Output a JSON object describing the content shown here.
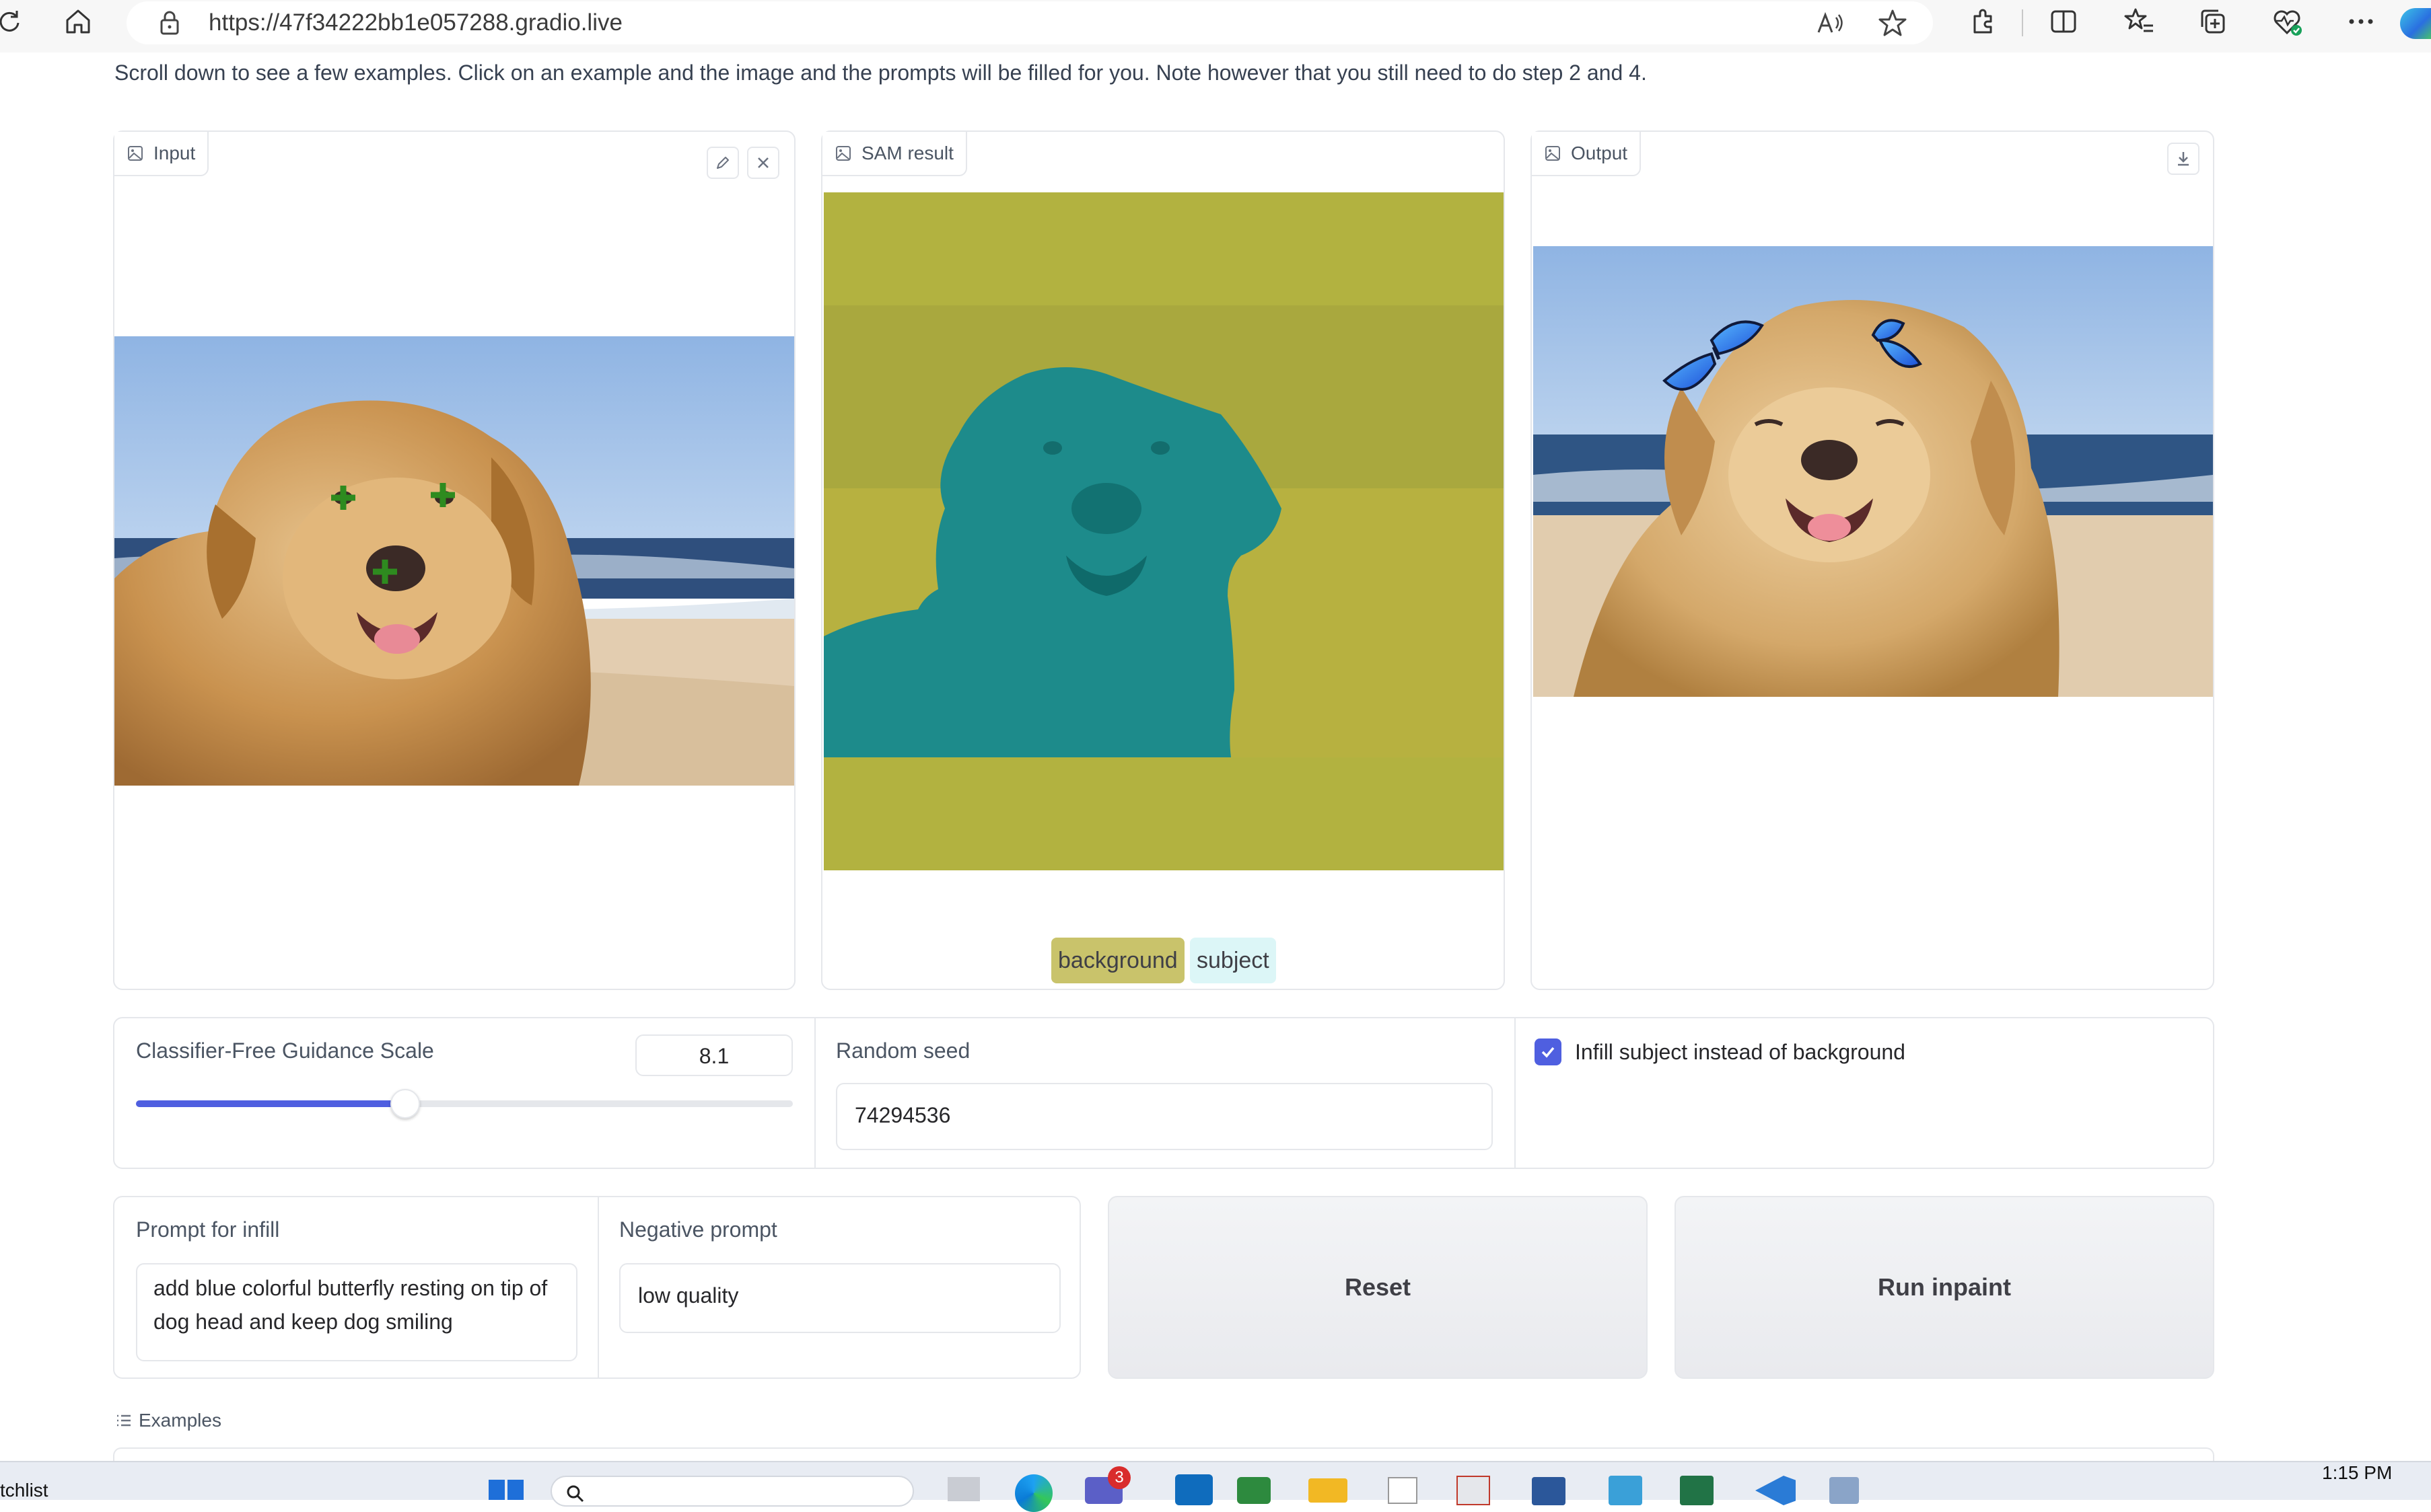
{
  "browser": {
    "url": "https://47f34222bb1e057288.gradio.live"
  },
  "intro_text": "Scroll down to see a few examples. Click on an example and the image and the prompts will be filled for you. Note however that you still need to do step 2 and 4.",
  "panels": {
    "input": {
      "label": "Input"
    },
    "sam": {
      "label": "SAM result",
      "legend": [
        "background",
        "subject"
      ]
    },
    "output": {
      "label": "Output"
    }
  },
  "controls": {
    "cfg": {
      "label": "Classifier-Free Guidance Scale",
      "value": "8.1",
      "slider_fraction": 0.41
    },
    "seed": {
      "label": "Random seed",
      "value": "74294536"
    },
    "infill_subject": {
      "label": "Infill subject instead of background",
      "checked": true
    }
  },
  "prompts": {
    "prompt": {
      "label": "Prompt for infill",
      "value": "add blue colorful butterfly resting on tip of dog head and keep dog smiling"
    },
    "negative": {
      "label": "Negative prompt",
      "value": "low quality"
    }
  },
  "buttons": {
    "reset": "Reset",
    "run": "Run inpaint"
  },
  "examples": {
    "label": "Examples"
  },
  "taskbar": {
    "left_text": "tchlist",
    "time": "1:15 PM",
    "badge": "3"
  },
  "colors": {
    "accent": "#4f5fe0",
    "mask_background": "#b2b240",
    "mask_subject": "#1d8b8b",
    "chip_background": "#c9c36b",
    "chip_subject": "#dcf6f7"
  }
}
